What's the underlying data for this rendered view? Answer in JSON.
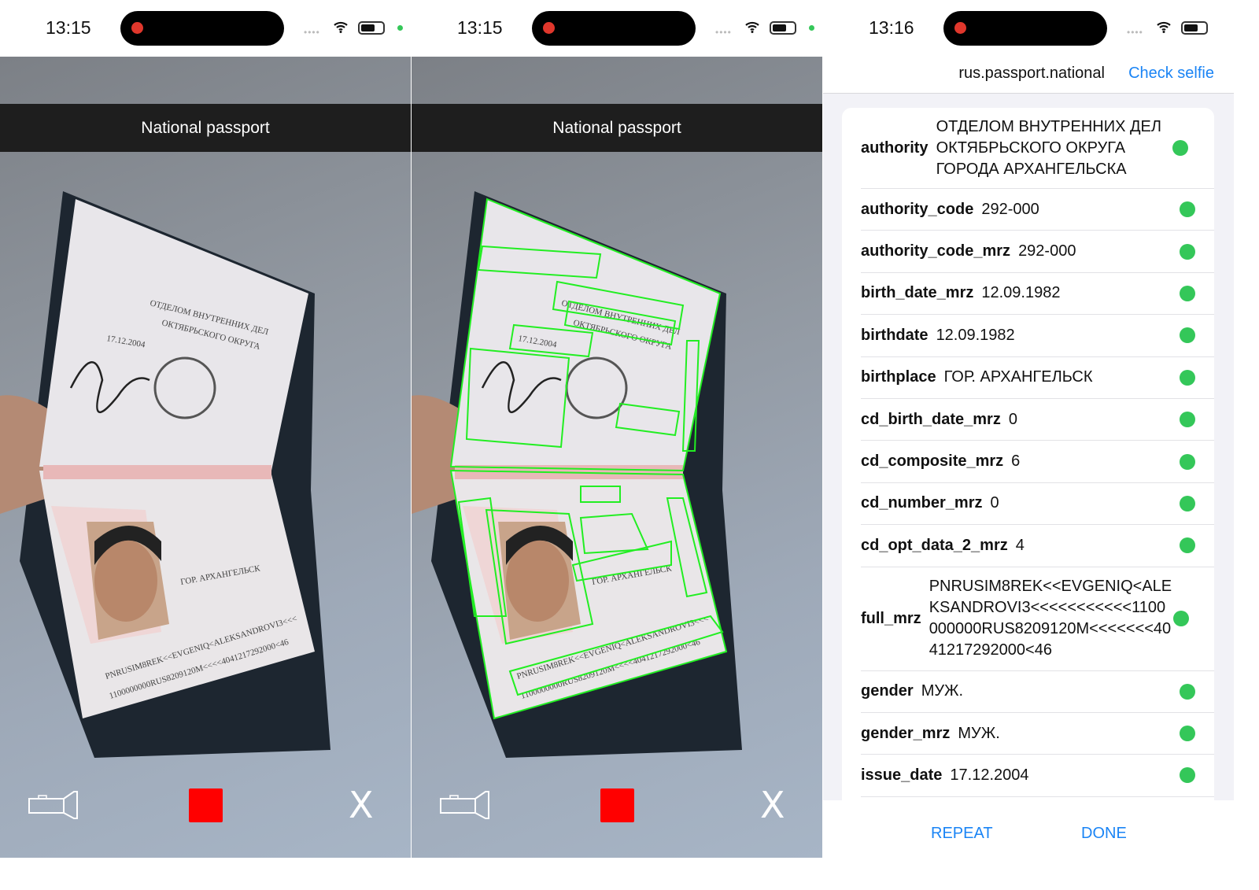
{
  "screens": [
    {
      "time": "13:15",
      "title": "National passport",
      "detection_boxes": false
    },
    {
      "time": "13:15",
      "title": "National passport",
      "detection_boxes": true
    }
  ],
  "result": {
    "time": "13:16",
    "doc_type": "rus.passport.national",
    "check_selfie": "Check selfie",
    "fields": [
      {
        "key": "authority",
        "value": "ОТДЕЛОМ ВНУТРЕННИХ ДЕЛ ОКТЯБРЬСКОГО ОКРУГА ГОРОДА АРХАНГЕЛЬСКА"
      },
      {
        "key": "authority_code",
        "value": "292-000"
      },
      {
        "key": "authority_code_mrz",
        "value": "292-000"
      },
      {
        "key": "birth_date_mrz",
        "value": "12.09.1982"
      },
      {
        "key": "birthdate",
        "value": "12.09.1982"
      },
      {
        "key": "birthplace",
        "value": "ГОР. АРХАНГЕЛЬСК"
      },
      {
        "key": "cd_birth_date_mrz",
        "value": "0"
      },
      {
        "key": "cd_composite_mrz",
        "value": "6"
      },
      {
        "key": "cd_number_mrz",
        "value": "0"
      },
      {
        "key": "cd_opt_data_2_mrz",
        "value": "4"
      },
      {
        "key": "full_mrz",
        "value": "PNRUSIM8REK<<EVGENIQ<ALEKSANDROVI3<<<<<<<<<<<1100000000RUS8209120M<<<<<<<4041217292000<46"
      },
      {
        "key": "gender",
        "value": "МУЖ."
      },
      {
        "key": "gender_mrz",
        "value": "МУЖ."
      },
      {
        "key": "issue_date",
        "value": "17.12.2004"
      }
    ],
    "repeat": "REPEAT",
    "done": "DONE"
  },
  "colors": {
    "accent": "#1a84f5",
    "valid": "#34c759",
    "stop": "#ff0000",
    "detection": "#22ee22"
  }
}
